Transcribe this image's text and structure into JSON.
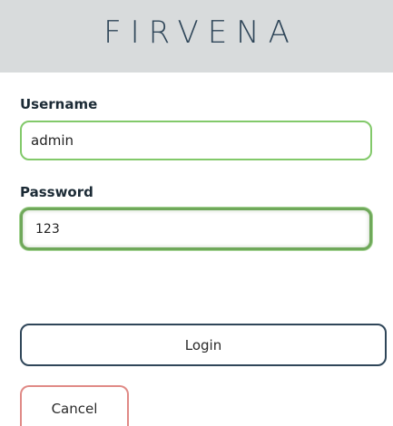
{
  "header": {
    "logo_text": "FIRVENA"
  },
  "form": {
    "username_label": "Username",
    "username_value": "admin",
    "password_label": "Password",
    "password_value": "123"
  },
  "buttons": {
    "login_label": "Login",
    "cancel_label": "Cancel"
  },
  "colors": {
    "header_bg": "#d8dbdc",
    "brand": "#2f4659",
    "input_border_green": "#82c96a",
    "cancel_border": "#e08a86"
  }
}
